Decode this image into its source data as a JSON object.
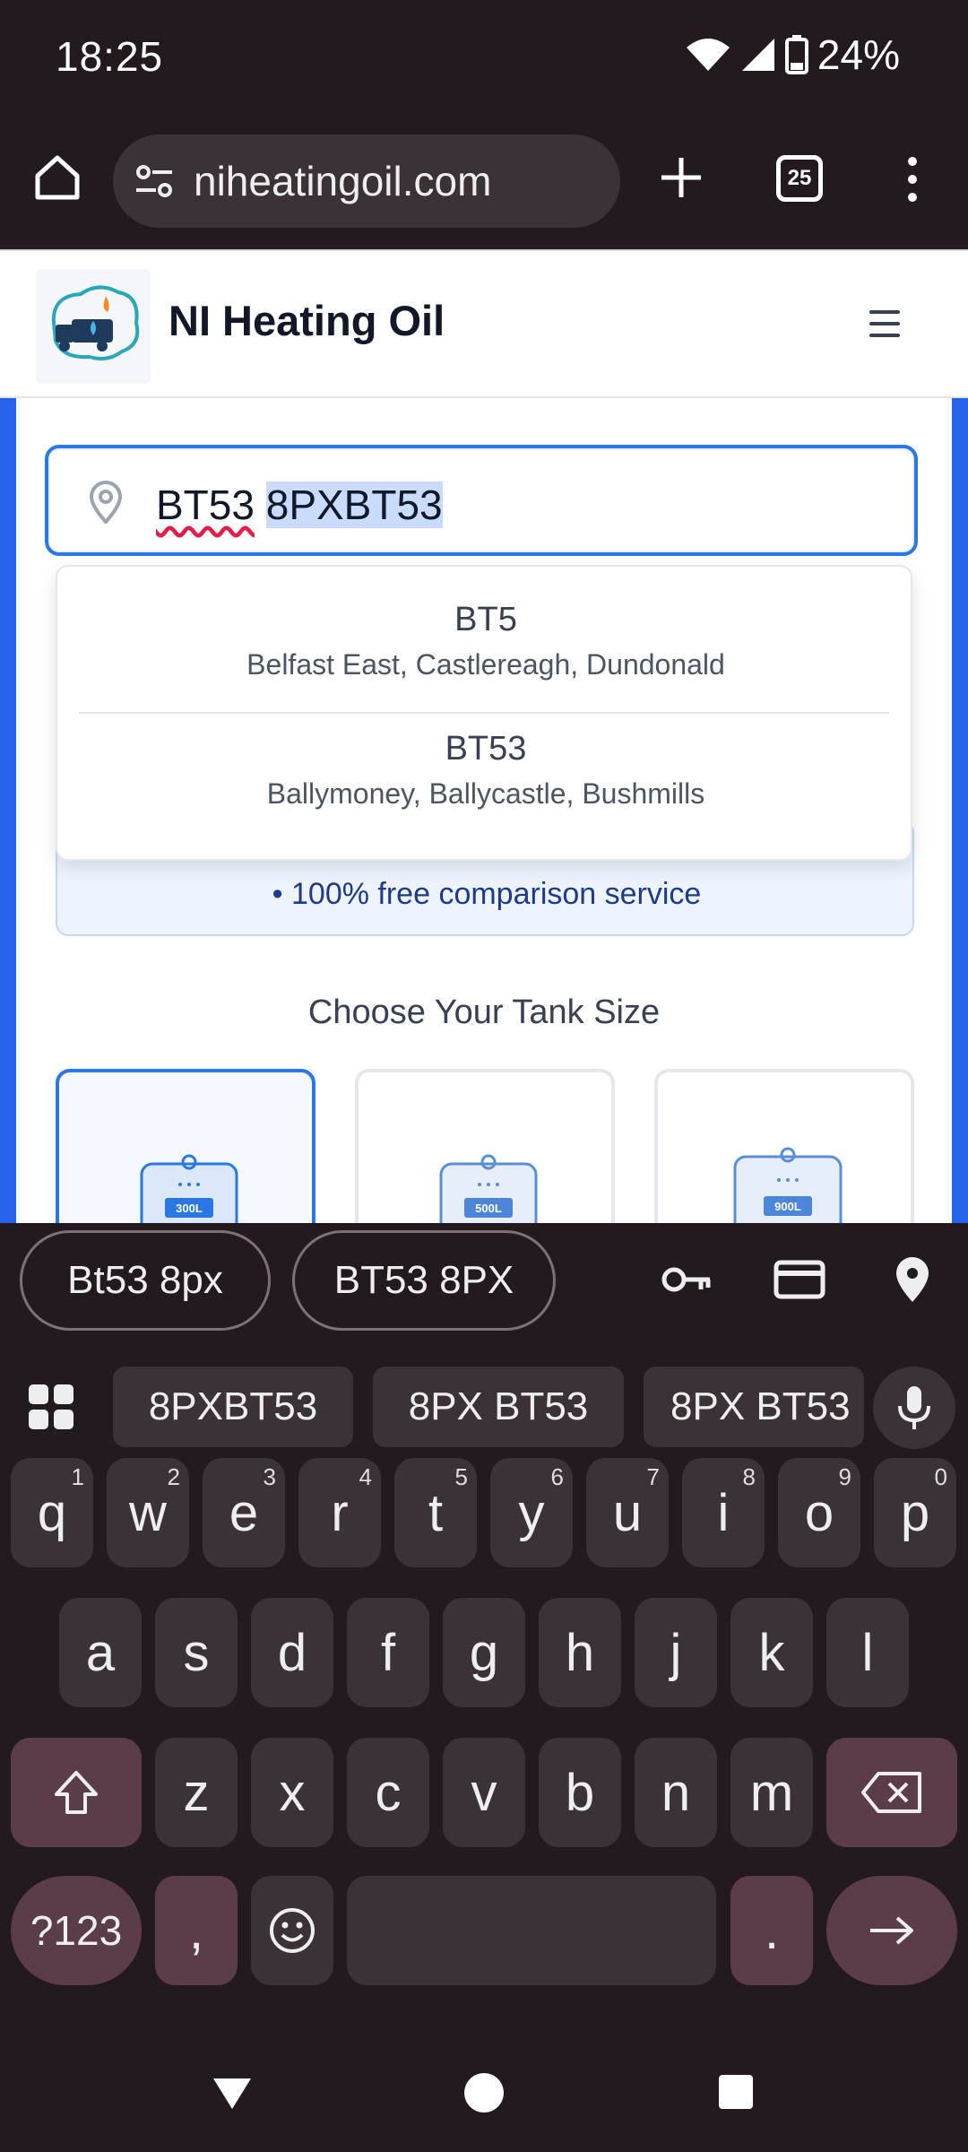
{
  "status": {
    "time": "18:25",
    "battery": "24%"
  },
  "browser": {
    "url": "niheatingoil.com",
    "tab_count": "25"
  },
  "site": {
    "name": "NI Heating Oil"
  },
  "search": {
    "typed": "BT53",
    "selected": "8PXBT53"
  },
  "dropdown": [
    {
      "code": "BT5",
      "areas": "Belfast East, Castlereagh, Dundonald"
    },
    {
      "code": "BT53",
      "areas": "Ballymoney, Ballycastle, Bushmills"
    }
  ],
  "info": {
    "bullet": "• 100% free comparison service"
  },
  "tanks": {
    "title": "Choose Your Tank Size",
    "sizes": [
      "300L",
      "500L",
      "900L"
    ]
  },
  "keyboard": {
    "autofill": [
      "Bt53 8px",
      "BT53 8PX"
    ],
    "suggestions": [
      "8PXBT53",
      "8PX BT53",
      "8PX BT53"
    ],
    "row1": [
      "q",
      "w",
      "e",
      "r",
      "t",
      "y",
      "u",
      "i",
      "o",
      "p"
    ],
    "row1_hints": [
      "1",
      "2",
      "3",
      "4",
      "5",
      "6",
      "7",
      "8",
      "9",
      "0"
    ],
    "row2": [
      "a",
      "s",
      "d",
      "f",
      "g",
      "h",
      "j",
      "k",
      "l"
    ],
    "row3": [
      "z",
      "x",
      "c",
      "v",
      "b",
      "n",
      "m"
    ],
    "symbols_key": "?123",
    "comma_key": ",",
    "period_key": "."
  }
}
